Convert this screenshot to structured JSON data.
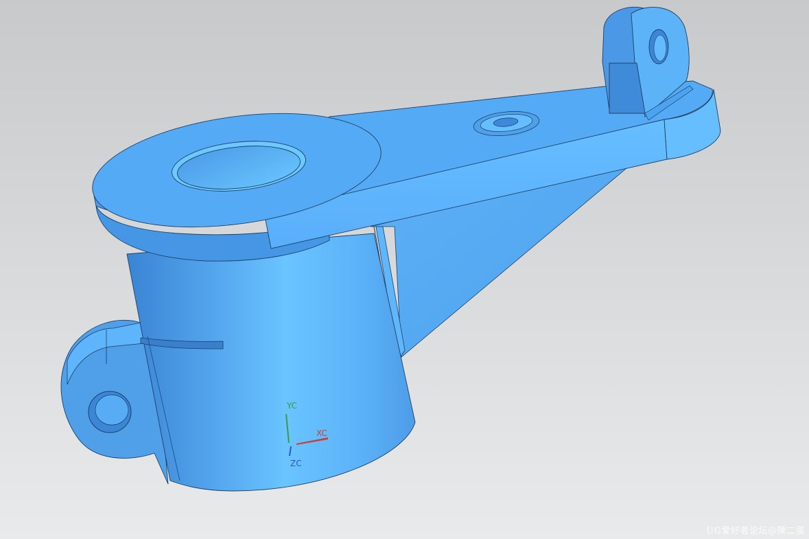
{
  "viewport": {
    "background_top": "#c7c9cb",
    "background_bottom": "#e9eaeb"
  },
  "model": {
    "body_color": "#55aaf5",
    "highlight_color": "#69c4ff",
    "shadow_color": "#3a84d4",
    "edge_color": "#1c3f66"
  },
  "triad": {
    "x_label": "XC",
    "y_label": "YC",
    "z_label": "ZC",
    "x_color": "#c8403a",
    "y_color": "#3a9c3c",
    "z_color": "#2a55d8"
  },
  "watermark": {
    "text": "UG爱好者论坛@陳二蛋"
  }
}
